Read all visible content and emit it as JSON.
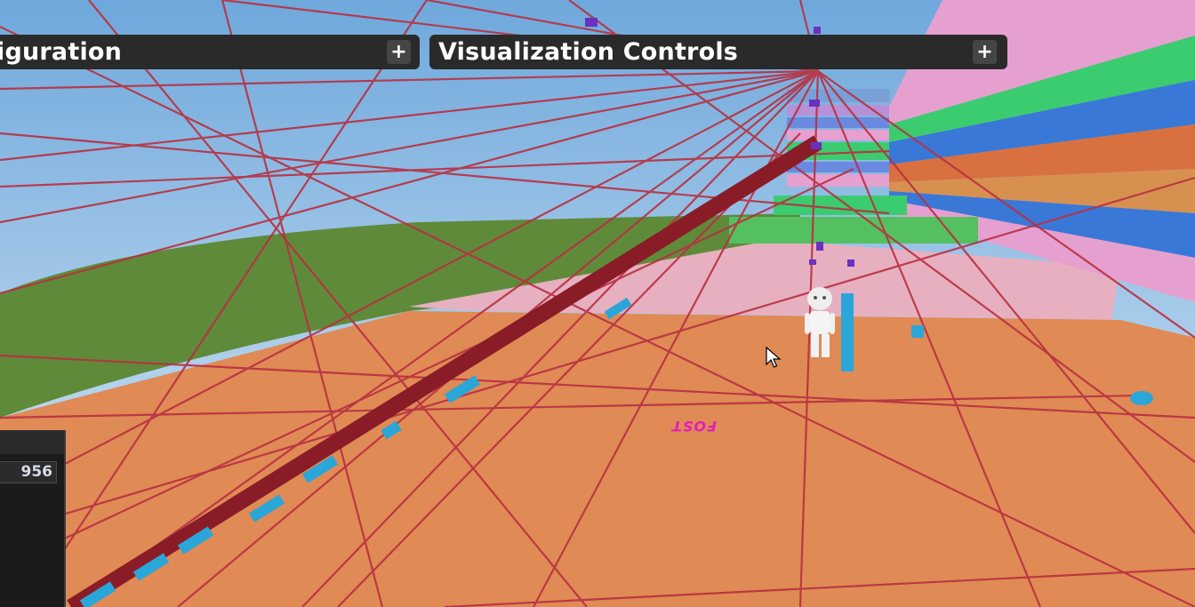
{
  "panels": {
    "configuration": {
      "title": "iguration",
      "expand_label": "+"
    },
    "visualization": {
      "title": "Visualization Controls",
      "expand_label": "+"
    }
  },
  "side_panel": {
    "value": "956"
  },
  "scene": {
    "floor_text": "FOST",
    "colors": {
      "sky": "#9cc4e4",
      "ground": "#e08a55",
      "grass": "#5f8a3a",
      "wire": "#c03040",
      "accent_blue": "#2aa6d8"
    }
  }
}
